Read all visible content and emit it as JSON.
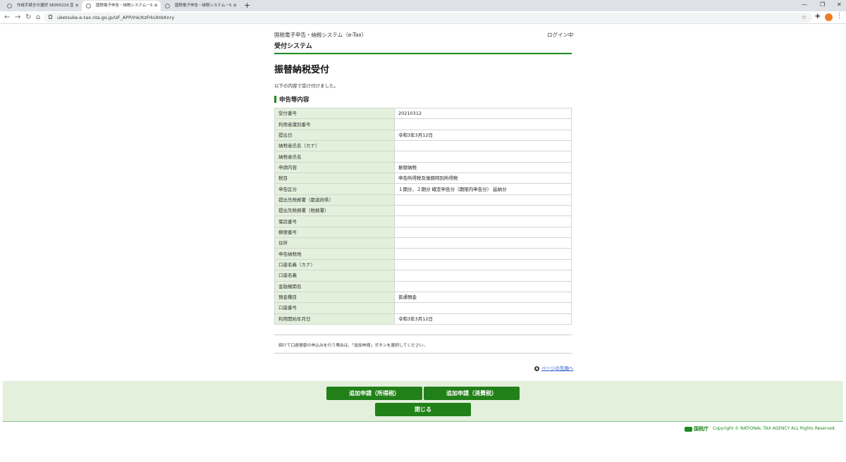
{
  "browser": {
    "tabs": [
      {
        "title": "作成手続きの選択 SE005210 国税",
        "active": false
      },
      {
        "title": "国税電子申告・納税システム－SU...",
        "active": true
      },
      {
        "title": "国税電子申告・納税システム－SU...",
        "active": false
      }
    ],
    "url": "uketsuke.e-tax.nta.go.jp/UF_APP/lnk/KzFrkUktkKnry",
    "icons": {
      "back": "back-arrow-icon",
      "forward": "forward-arrow-icon",
      "reload": "reload-icon",
      "home": "home-icon",
      "lock": "lock-icon",
      "star": "star-icon",
      "extensions": "puzzle-icon",
      "menu": "kebab-icon"
    }
  },
  "header": {
    "site_name": "国税電子申告・納税システム（e-Tax）",
    "login_status": "ログイン中",
    "system_name": "受付システム"
  },
  "main": {
    "title": "振替納税受付",
    "intro": "以下の内容で受け付けました。",
    "section_title": "申告等内容",
    "rows": [
      {
        "label": "受付番号",
        "value": "20210312"
      },
      {
        "label": "利用者識別番号",
        "value": ""
      },
      {
        "label": "提出日",
        "value": "令和3年3月12日"
      },
      {
        "label": "納税者氏名（カナ）",
        "value": ""
      },
      {
        "label": "納税者氏名",
        "value": ""
      },
      {
        "label": "申請内容",
        "value": "振替納税"
      },
      {
        "label": "税目",
        "value": "申告所得税及復興特別所得税"
      },
      {
        "label": "申告区分",
        "value": "１期分、２期分 確定申告分（期限内申告分） 延納分"
      },
      {
        "label": "提出先税務署（都道府県）",
        "value": ""
      },
      {
        "label": "提出先税務署（税務署）",
        "value": ""
      },
      {
        "label": "電話番号",
        "value": ""
      },
      {
        "label": "郵便番号",
        "value": ""
      },
      {
        "label": "住所",
        "value": ""
      },
      {
        "label": "申告納税地",
        "value": ""
      },
      {
        "label": "口座名義（カナ）",
        "value": ""
      },
      {
        "label": "口座名義",
        "value": ""
      },
      {
        "label": "金融機関名",
        "value": ""
      },
      {
        "label": "預金種目",
        "value": "普通預金"
      },
      {
        "label": "口座番号",
        "value": ""
      },
      {
        "label": "利用開始年月日",
        "value": "令和3年3月12日"
      }
    ],
    "notice": "続けて口座振替の申込みを行う場合は、「追加申請」ボタンを選択してください。",
    "page_top_link": "ページの先頭へ"
  },
  "actions": {
    "add_income_tax": "追加申請（所得税）",
    "add_consumption_tax": "追加申請（消費税）",
    "close": "閉じる"
  },
  "footer": {
    "agency": "国税庁",
    "copyright": "Copyright © NATIONAL TAX AGENCY ALL Rights Reserved."
  },
  "colors": {
    "accent_green": "#228018",
    "table_label_bg": "#e3f0dc",
    "action_area_bg": "#e3f0dc"
  }
}
